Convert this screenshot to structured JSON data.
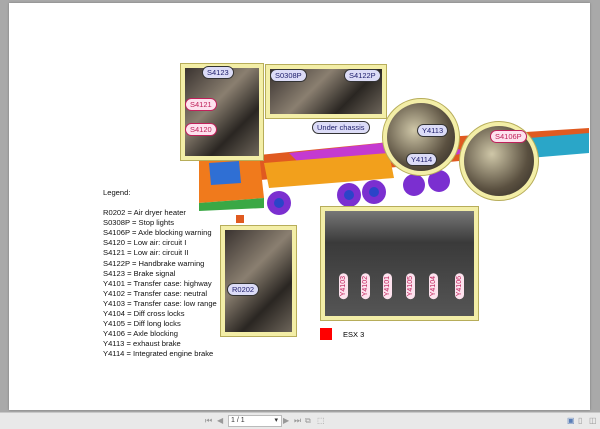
{
  "diagram": {
    "labels": {
      "s4123": "S4123",
      "s4121": "S4121",
      "s4120": "S4120",
      "s0308p": "S0308P",
      "s4122p": "S4122P",
      "under_chassis": "Under chassis",
      "y4113": "Y4113",
      "y4114": "Y4114",
      "s4106p": "S4106P",
      "r0202": "R0202",
      "valves": [
        "Y4103",
        "Y4102",
        "Y4101",
        "Y4105",
        "Y4104",
        "Y4106"
      ]
    },
    "esx": {
      "label": "ESX 3",
      "color": "#ff0000"
    }
  },
  "legend": {
    "title": "Legend:",
    "items": [
      "R0202 = Air dryer heater",
      "S0308P = Stop lights",
      "S4106P = Axle blocking warning",
      "S4120 = Low air: circuit I",
      "S4121 = Low air: circuit II",
      "S4122P = Handbrake warning",
      "S4123 = Brake signal",
      "Y4101 = Transfer case: highway",
      "Y4102 = Transfer case: neutral",
      "Y4103 = Transfer case: low range",
      "Y4104 = Diff cross locks",
      "Y4105 = Diff long locks",
      "Y4106 = Axle blocking",
      "Y4113 = exhaust brake",
      "Y4114 = Integrated engine brake"
    ]
  },
  "toolbar": {
    "page": "1 / 1"
  }
}
